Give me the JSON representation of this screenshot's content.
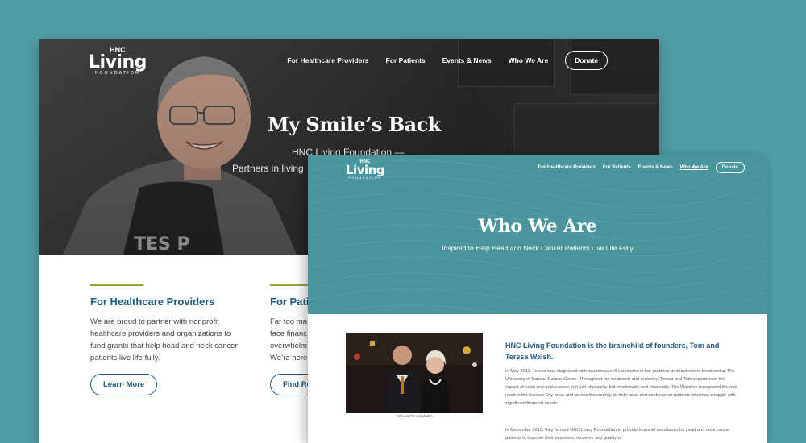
{
  "back_page": {
    "logo": {
      "top": "HNC",
      "main": "Living",
      "bottom": "FOUNDATION"
    },
    "nav": [
      "For Healthcare Providers",
      "For Patients",
      "Events & News",
      "Who We Are"
    ],
    "donate_label": "Donate",
    "hero": {
      "title": "My Smile’s Back",
      "line1": "HNC Living Foundation —",
      "line2": "Partners in living"
    },
    "columns": [
      {
        "heading": "For Healthcare Providers",
        "body": "We are proud to partner with nonprofit healthcare providers and organizations to fund grants that help head and neck cancer patients live life fully.",
        "button": "Learn More"
      },
      {
        "heading": "For Patie",
        "lines": [
          "Far too ma",
          "face financ",
          "overwhelm",
          "We’re here"
        ],
        "button": "Find Re"
      }
    ]
  },
  "front_page": {
    "logo": {
      "top": "HNC",
      "main": "Living",
      "bottom": "FOUNDATION"
    },
    "nav": [
      "For Healthcare Providers",
      "For Patients",
      "Events & News",
      "Who We Are"
    ],
    "active_nav": "Who We Are",
    "donate_label": "Donate",
    "hero": {
      "title": "Who We Are",
      "subtitle": "Inspired to Help Head and Neck Cancer Patients Live Life Fully"
    },
    "photo_caption": "Tom and Teresa Walsh",
    "intro_heading": "HNC Living Foundation is the brainchild of founders, Tom and Teresa Walsh.",
    "paragraph1": "In May 2013, Teresa was diagnosed with squamous cell carcinoma in her jawbone and underwent treatment at The University of Kansas Cancer Center. Throughout her treatment and recovery, Teresa and Tom experienced the impact of head and neck cancer, not just physically, but emotionally and financially. The Walshes recognized the real need in the Kansas City area, and across the country, to help head and neck cancer patients who may struggle with significant financial needs.",
    "paragraph2": "In December 2013, they formed HNC Living Foundation to provide financial assistance for head and neck cancer patients to improve their treatment, recovery and quality of"
  },
  "colors": {
    "background": "#4f9ea6",
    "front_hero": "#4a959d",
    "heading_blue": "#1f5a7e",
    "accent_olive": "#9aa23b"
  }
}
